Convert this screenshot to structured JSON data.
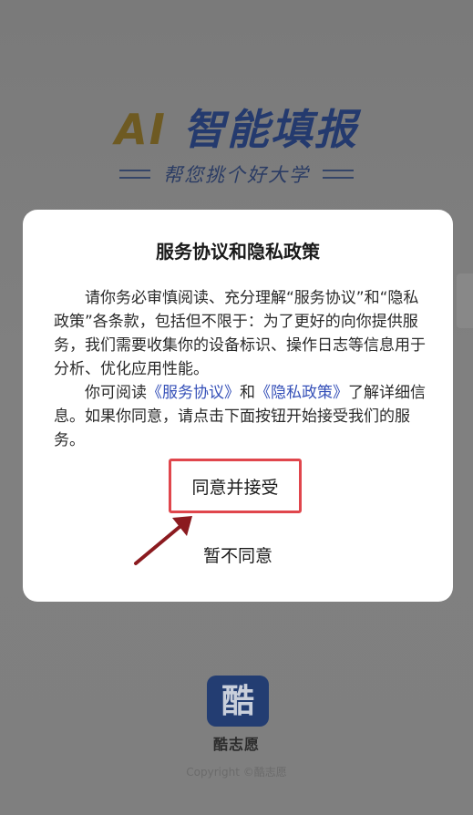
{
  "splash": {
    "title_ai": "AI",
    "title_rest": "智能填报",
    "slogan": "帮您挑个好大学",
    "app_icon_char": "酷",
    "app_name": "酷志愿",
    "copyright": "Copyright ©酷志愿"
  },
  "dialog": {
    "title": "服务协议和隐私政策",
    "para1": "请你务必审慎阅读、充分理解“服务协议”和“隐私政策”各条款，包括但不限于：为了更好的向你提供服务，我们需要收集你的设备标识、操作日志等信息用于分析、优化应用性能。",
    "para2_prefix": "你可阅读",
    "link_service": "《服务协议》",
    "para2_and": "和",
    "link_privacy": "《隐私政策》",
    "para2_suffix": "了解详细信息。如果你同意，请点击下面按钮开始接受我们的服务。",
    "agree_label": "同意并接受",
    "decline_label": "暂不同意"
  },
  "colors": {
    "overlay_bg": "#7d7d7d",
    "highlight_border": "#e0464c",
    "arrow": "#8b1a1f",
    "link": "#3550b8",
    "app_icon_bg": "#233d72"
  },
  "icons": {
    "annotation_arrow": "arrow-up-right-icon",
    "slogan_decoration": "double-line-icon"
  }
}
